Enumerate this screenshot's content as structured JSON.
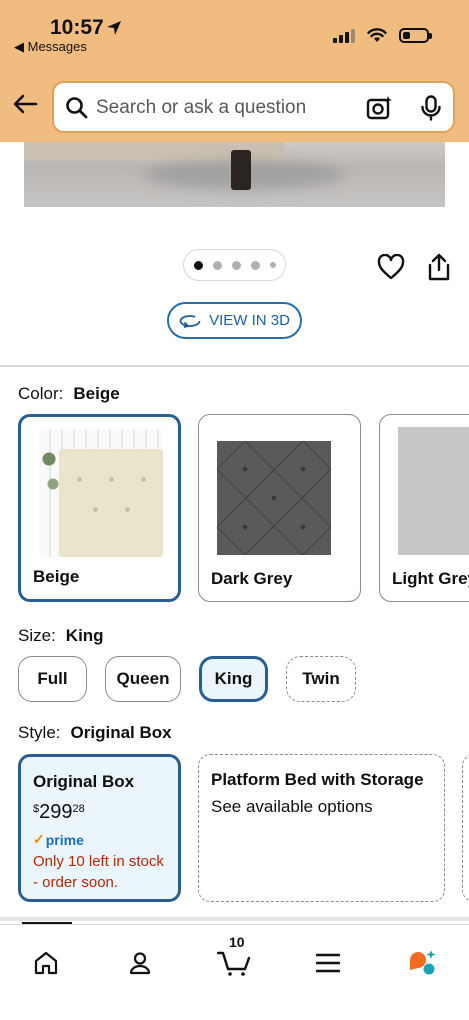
{
  "status_bar": {
    "time": "10:57",
    "back_app": "◀ Messages",
    "battery_fraction": 0.3
  },
  "search": {
    "placeholder": "Search or ask a question",
    "value": ""
  },
  "gallery": {
    "page_count": 5,
    "active_index": 0
  },
  "view3d": {
    "label": "VIEW IN 3D"
  },
  "color": {
    "label": "Color:",
    "selected": "Beige",
    "options": [
      "Beige",
      "Dark Grey",
      "Light Grey"
    ]
  },
  "size": {
    "label": "Size:",
    "selected": "King",
    "options": [
      "Full",
      "Queen",
      "King",
      "Twin"
    ]
  },
  "style": {
    "label": "Style:",
    "selected": "Original Box",
    "options": [
      {
        "title": "Original Box",
        "price_currency": "$",
        "price_whole": "299",
        "price_fraction": "28",
        "prime": "prime",
        "stock": "Only 10 left in stock - order soon."
      },
      {
        "title": "Platform Bed with Storage",
        "subtitle": "See available options"
      }
    ]
  },
  "nav": {
    "cart_count": "10",
    "items": [
      "home-icon",
      "account-icon",
      "cart-icon",
      "menu-icon",
      "rufus-icon"
    ]
  },
  "colors": {
    "header": "#f1bc80",
    "accent_blue": "#2a5e91",
    "selected_bg": "#eaf6fb",
    "stock_red": "#b12704",
    "prime_blue": "#1a6fb9"
  }
}
